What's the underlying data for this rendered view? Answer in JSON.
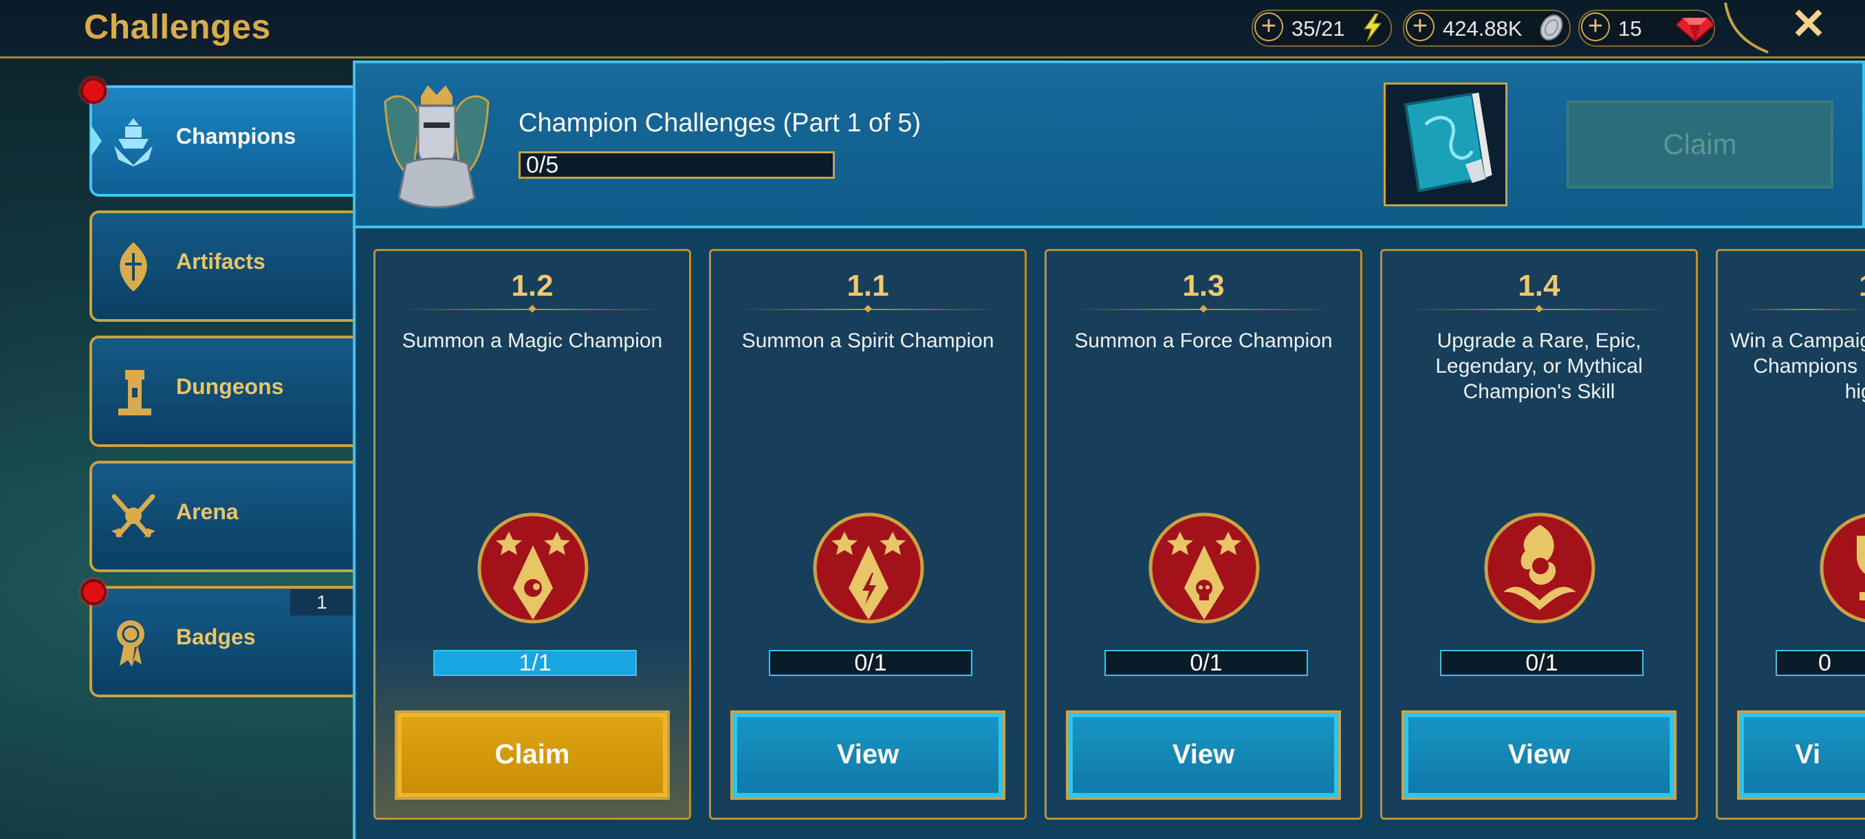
{
  "app": {
    "title": "Challenges"
  },
  "resources": {
    "energy": {
      "value": "35/21",
      "icon": "lightning-icon"
    },
    "silver": {
      "value": "424.88K",
      "icon": "silver-coin-icon"
    },
    "gems": {
      "value": "15",
      "icon": "ruby-gem-icon"
    }
  },
  "sidebar": {
    "items": [
      {
        "label": "Champions",
        "icon": "champion-helm-icon",
        "active": true,
        "notification": true
      },
      {
        "label": "Artifacts",
        "icon": "artifact-icon",
        "active": false,
        "notification": false
      },
      {
        "label": "Dungeons",
        "icon": "dungeon-tower-icon",
        "active": false,
        "notification": false
      },
      {
        "label": "Arena",
        "icon": "crossed-swords-icon",
        "active": false,
        "notification": false
      },
      {
        "label": "Badges",
        "icon": "badge-ribbon-icon",
        "active": false,
        "notification": true,
        "count": "1"
      }
    ]
  },
  "header": {
    "title": "Champion Challenges (Part 1 of 5)",
    "progress_text": "0/5",
    "progress": 0,
    "claim_label": "Claim",
    "claim_enabled": false
  },
  "cards": [
    {
      "number": "1.2",
      "description": "Summon a Magic Champion",
      "progress_text": "1/1",
      "progress": 1,
      "button": "Claim",
      "emblem": "magic-summon-emblem"
    },
    {
      "number": "1.1",
      "description": "Summon a Spirit Champion",
      "progress_text": "0/1",
      "progress": 0,
      "button": "View",
      "emblem": "spirit-summon-emblem"
    },
    {
      "number": "1.3",
      "description": "Summon a Force Champion",
      "progress_text": "0/1",
      "progress": 0,
      "button": "View",
      "emblem": "force-summon-emblem"
    },
    {
      "number": "1.4",
      "description": "Upgrade a Rare, Epic, Legendary, or Mythical Champion's Skill",
      "progress_text": "0/1",
      "progress": 0,
      "button": "View",
      "emblem": "skill-upgrade-emblem"
    },
    {
      "number": "1",
      "description": "Win a Campaig Champions hig",
      "progress_text": "0",
      "progress": 0,
      "button": "Vi",
      "emblem": "trophy-emblem"
    }
  ],
  "colors": {
    "accent_gold": "#d9ab4c",
    "accent_blue": "#3ec0ec",
    "claim_orange": "#e0a612"
  }
}
